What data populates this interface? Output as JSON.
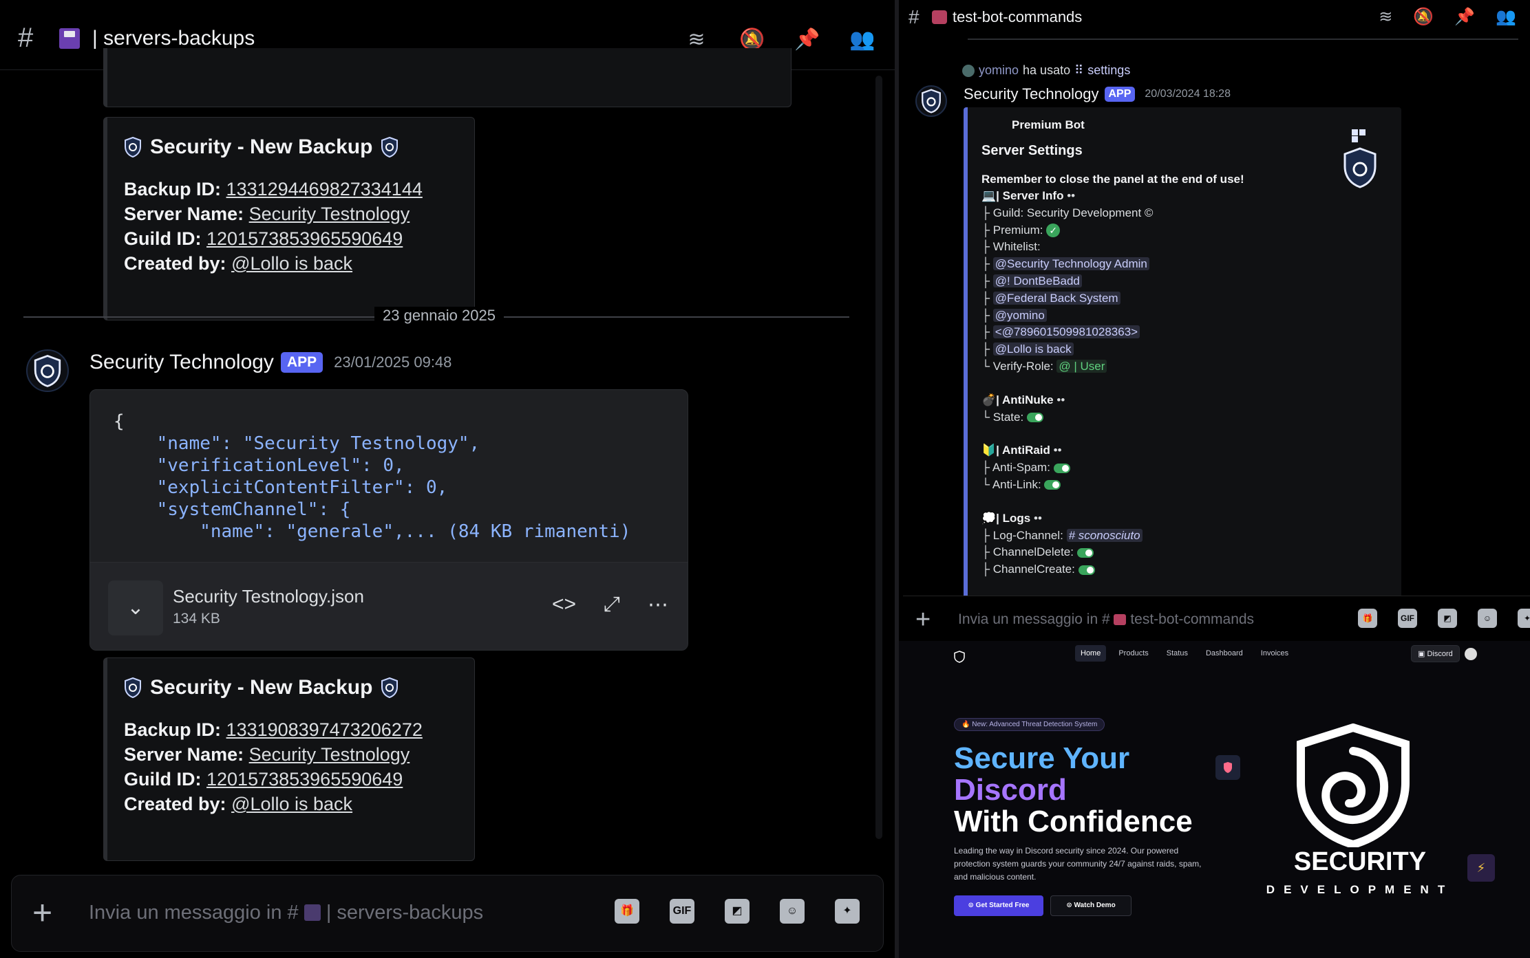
{
  "left": {
    "channel_name": "| servers-backups",
    "embed1": {
      "title": "Security - New Backup",
      "backup_id_label": "Backup ID:",
      "backup_id": "1331294469827334144",
      "server_name_label": "Server Name:",
      "server_name": "Security Testnology",
      "guild_id_label": "Guild ID:",
      "guild_id": "1201573853965590649",
      "created_by_label": "Created by:",
      "created_by": "@Lollo is back"
    },
    "date_separator": "23 gennaio 2025",
    "message": {
      "author": "Security Technology",
      "tag": "APP",
      "timestamp": "23/01/2025 09:48"
    },
    "code_lines": [
      "{",
      "    \"name\": \"Security Testnology\",",
      "    \"verificationLevel\": 0,",
      "    \"explicitContentFilter\": 0,",
      "    \"systemChannel\": {",
      "        \"name\": \"generale\",... (84 KB rimanenti)"
    ],
    "file": {
      "name": "Security Testnology.json",
      "size": "134 KB"
    },
    "embed2": {
      "title": "Security - New Backup",
      "backup_id_label": "Backup ID:",
      "backup_id": "1331908397473206272",
      "server_name_label": "Server Name:",
      "server_name": "Security Testnology",
      "guild_id_label": "Guild ID:",
      "guild_id": "1201573853965590649",
      "created_by_label": "Created by:",
      "created_by": "@Lollo is back"
    },
    "composer_placeholder": "Invia un messaggio in #",
    "composer_channel": "| servers-backups",
    "gif_label": "GIF"
  },
  "right_top": {
    "channel_name": "test-bot-commands",
    "reply": {
      "user": "yomino",
      "verb": "ha usato",
      "command": "settings"
    },
    "author": "Security Technology",
    "tag": "APP",
    "timestamp": "20/03/2024 18:28",
    "embed": {
      "premium": "Premium Bot",
      "title": "Server Settings",
      "reminder": "Remember to close the panel at the end of use!",
      "server_info": "| Server Info",
      "guild": "Guild: Security Development ©",
      "premium_label": "Premium:",
      "whitelist": "Whitelist:",
      "whitelist_items": [
        "@Security Technology Admin",
        "@! DontBeBadd",
        "@Federal Back System",
        "@yomino",
        "<@789601509981028363>",
        "@Lollo is back"
      ],
      "verify_role_label": "Verify-Role:",
      "verify_role": "@ | User",
      "antinuke": "| AntiNuke",
      "state": "State:",
      "antiraid": "| AntiRaid",
      "anti_spam": "Anti-Spam:",
      "anti_link": "Anti-Link:",
      "logs": "| Logs",
      "log_channel": "Log-Channel:",
      "log_channel_value": "# sconosciuto",
      "channel_delete": "ChannelDelete:",
      "channel_create": "ChannelCreate:"
    },
    "composer_placeholder": "Invia un messaggio in #",
    "composer_channel": "test-bot-commands",
    "gif_label": "GIF"
  },
  "site": {
    "nav": [
      "Home",
      "Products",
      "Status",
      "Dashboard",
      "Invoices"
    ],
    "discord_btn": "Discord",
    "badge": "New: Advanced Threat Detection System",
    "headline1": "Secure Your",
    "headline2": "Discord",
    "headline3": "With Confidence",
    "lead": "Leading the way in Discord security since 2024. Our powered protection system guards your community 24/7 against raids, spam, and malicious content.",
    "cta_primary": "Get Started Free",
    "cta_secondary": "Watch Demo",
    "brand_main": "SECURITY",
    "brand_sub": "DEVELOPMENT"
  },
  "colors": {
    "app_tag": "#5865f2",
    "embed_border": "#5a6dd8",
    "accent_purple": "#4b3fe0",
    "toggle_on": "#3aa55c"
  }
}
